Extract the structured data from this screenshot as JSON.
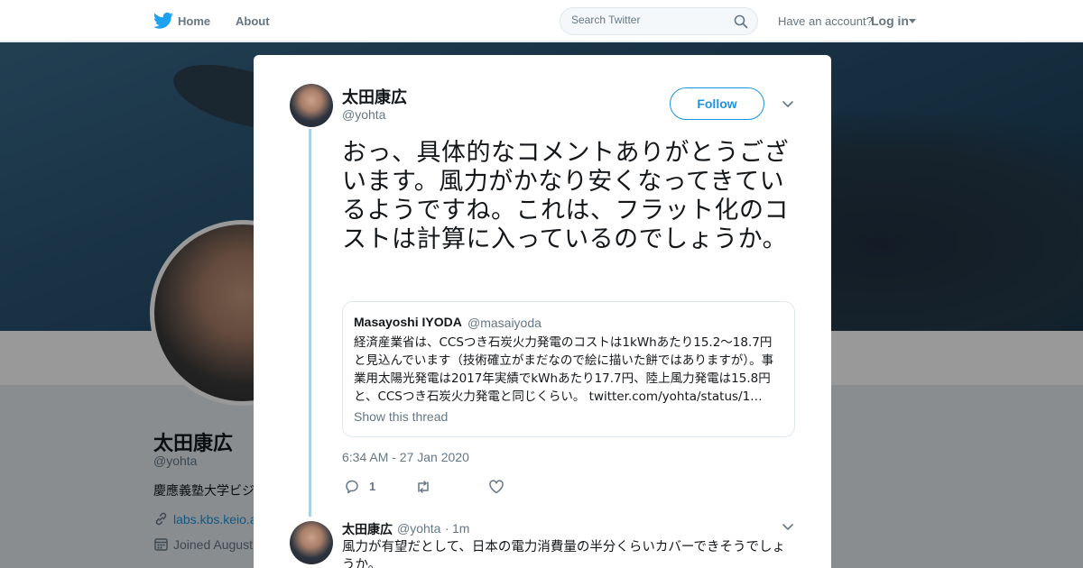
{
  "nav": {
    "home_label": "Home",
    "about_label": "About",
    "search_placeholder": "Search Twitter",
    "have_account": "Have an account?",
    "login_label": "Log in"
  },
  "profile": {
    "name": "太田康広",
    "handle": "@yohta",
    "bio": "慶應義塾大学ビジ",
    "link": "labs.kbs.keio.a",
    "joined": "Joined August"
  },
  "tweet": {
    "author_name": "太田康広",
    "author_handle": "@yohta",
    "follow_label": "Follow",
    "text": "おっ、具体的なコメントありがとうございます。風力がかなり安くなってきているようですね。これは、フラット化のコストは計算に入っているのでしょうか。",
    "timestamp": "6:34 AM - 27 Jan 2020",
    "reply_count": "1"
  },
  "quoted": {
    "name": "Masayoshi IYODA",
    "handle": "@masaiyoda",
    "text": "経済産業省は、CCSつき石炭火力発電のコストは1kWhあたり15.2～18.7円と見込んでいます（技術確立がまだなので絵に描いた餅ではありますが）。事業用太陽光発電は2017年実績でkWhあたり17.7円、陸上風力発電は15.8円と、CCSつき石炭火力発電と同じくらい。 twitter.com/yohta/status/1…",
    "show_thread": "Show this thread"
  },
  "reply": {
    "name": "太田康広",
    "handle": "@yohta",
    "separator": "·",
    "time": "1m",
    "text": "風力が有望だとして、日本の電力消費量の半分くらいカバーできそうでしょうか。"
  },
  "colors": {
    "accent": "#1b95e0",
    "thread_line": "#a8d1ea",
    "secondary_text": "#657786"
  }
}
